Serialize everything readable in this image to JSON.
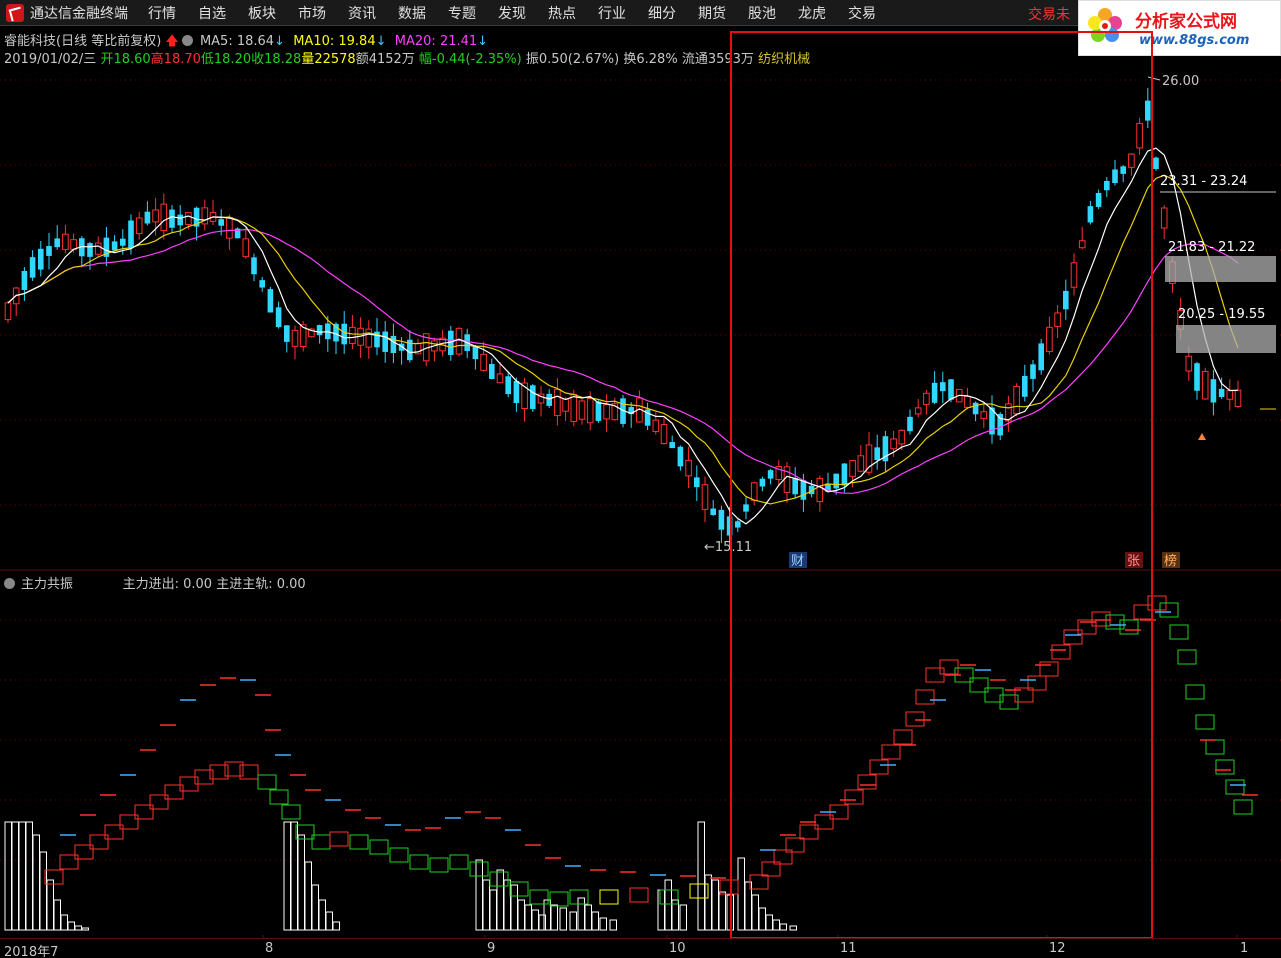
{
  "menubar": {
    "app_title": "通达信金融终端",
    "items": [
      "行情",
      "自选",
      "板块",
      "市场",
      "资讯",
      "数据",
      "专题",
      "发现",
      "热点",
      "行业",
      "细分",
      "期货",
      "股池",
      "龙虎",
      "交易"
    ],
    "trade_status": "交易未"
  },
  "watermark": {
    "title": "分析家公式网",
    "url": "www.88gs.com"
  },
  "header": {
    "stock_name": "睿能科技(日线 等比前复权)",
    "ma5_label": "MA5: 18.64",
    "ma10_label": "MA10: 19.84",
    "ma20_label": "MA20: 21.41"
  },
  "quote": {
    "date": "2019/01/02/三",
    "open": "开18.60",
    "high": "高18.70",
    "low": "低18.20",
    "close": "收18.28",
    "volume": "量22578",
    "amount": "额4152万",
    "change": "幅-0.44(-2.35%)",
    "amplitude": "振0.50(2.67%)",
    "turnover": "换6.28%",
    "float": "流通3593万",
    "industry": "纺织机械"
  },
  "annotations": {
    "high_label": "26.00",
    "low_label": "←15.11",
    "zone1": "23.31 - 23.24",
    "zone2": "21.83 - 21.22",
    "zone3": "20.25 - 19.55",
    "marker_cai": "财",
    "marker_zhang": "张",
    "marker_bang": "榜"
  },
  "indicator": {
    "name": "主力共振",
    "v1": "主力进出: 0.00",
    "v2": "主进主轨: 0.00"
  },
  "date_axis": [
    "2018年7",
    "8",
    "9",
    "10",
    "11",
    "12",
    "1"
  ],
  "colors": {
    "up": "#ff3030",
    "down": "#30d8ff",
    "ma5": "#ffffff",
    "ma10": "#e8d000",
    "ma20": "#ff40ff",
    "highlight_box": "#e01010"
  },
  "chart_data": {
    "type": "candlestick",
    "y_range": [
      14.5,
      27
    ],
    "candles": [
      [
        18.6,
        18.7,
        18.2,
        18.28
      ]
    ]
  }
}
